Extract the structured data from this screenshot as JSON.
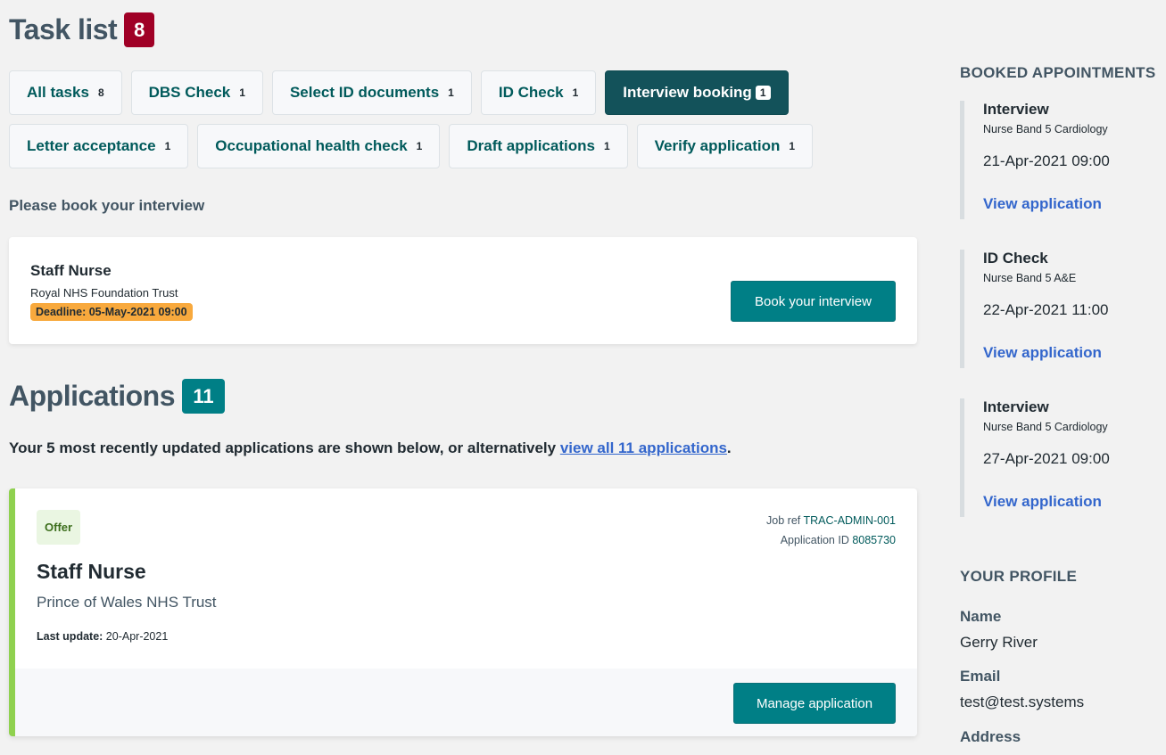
{
  "task_list": {
    "title": "Task list",
    "count": "8",
    "tabs": [
      {
        "label": "All tasks",
        "count": "8",
        "active": false
      },
      {
        "label": "DBS Check",
        "count": "1",
        "active": false
      },
      {
        "label": "Select ID documents",
        "count": "1",
        "active": false
      },
      {
        "label": "ID Check",
        "count": "1",
        "active": false
      },
      {
        "label": "Interview booking",
        "count": "1",
        "active": true
      },
      {
        "label": "Letter acceptance",
        "count": "1",
        "active": false
      },
      {
        "label": "Occupational health check",
        "count": "1",
        "active": false
      },
      {
        "label": "Draft applications",
        "count": "1",
        "active": false
      },
      {
        "label": "Verify application",
        "count": "1",
        "active": false
      }
    ],
    "section_label": "Please book your interview",
    "task_card": {
      "job_title": "Staff Nurse",
      "employer": "Royal NHS Foundation Trust",
      "deadline": "Deadline: 05-May-2021 09:00",
      "button_label": "Book your interview"
    }
  },
  "applications": {
    "title": "Applications",
    "count": "11",
    "intro_text": "Your 5 most recently updated applications are shown below, or alternatively ",
    "intro_link": "view all 11 applications",
    "intro_end": ".",
    "cards": [
      {
        "status": "Offer",
        "job_title": "Staff Nurse",
        "employer": "Prince of Wales NHS Trust",
        "last_update_label": "Last update:",
        "last_update_value": "20-Apr-2021",
        "job_ref_label": "Job ref",
        "job_ref_value": "TRAC-ADMIN-001",
        "app_id_label": "Application ID",
        "app_id_value": "8085730",
        "button_label": "Manage application"
      }
    ]
  },
  "sidebar": {
    "appointments_heading": "BOOKED APPOINTMENTS",
    "appointments": [
      {
        "type": "Interview",
        "role": "Nurse Band 5 Cardiology",
        "datetime": "21-Apr-2021 09:00",
        "link": "View application"
      },
      {
        "type": "ID Check",
        "role": "Nurse Band 5 A&E",
        "datetime": "22-Apr-2021 11:00",
        "link": "View application"
      },
      {
        "type": "Interview",
        "role": "Nurse Band 5 Cardiology",
        "datetime": "27-Apr-2021 09:00",
        "link": "View application"
      }
    ],
    "profile_heading": "YOUR PROFILE",
    "profile": {
      "name_label": "Name",
      "name_value": "Gerry River",
      "email_label": "Email",
      "email_value": "test@test.systems",
      "address_label": "Address"
    }
  },
  "colors": {
    "task_count_badge": "#a00026",
    "app_count_badge": "#007f86",
    "active_tab": "#13525a",
    "primary_button": "#007f86",
    "deadline_tag": "#f8a93d",
    "offer_border": "#8fd14f",
    "link": "#3366cc"
  }
}
